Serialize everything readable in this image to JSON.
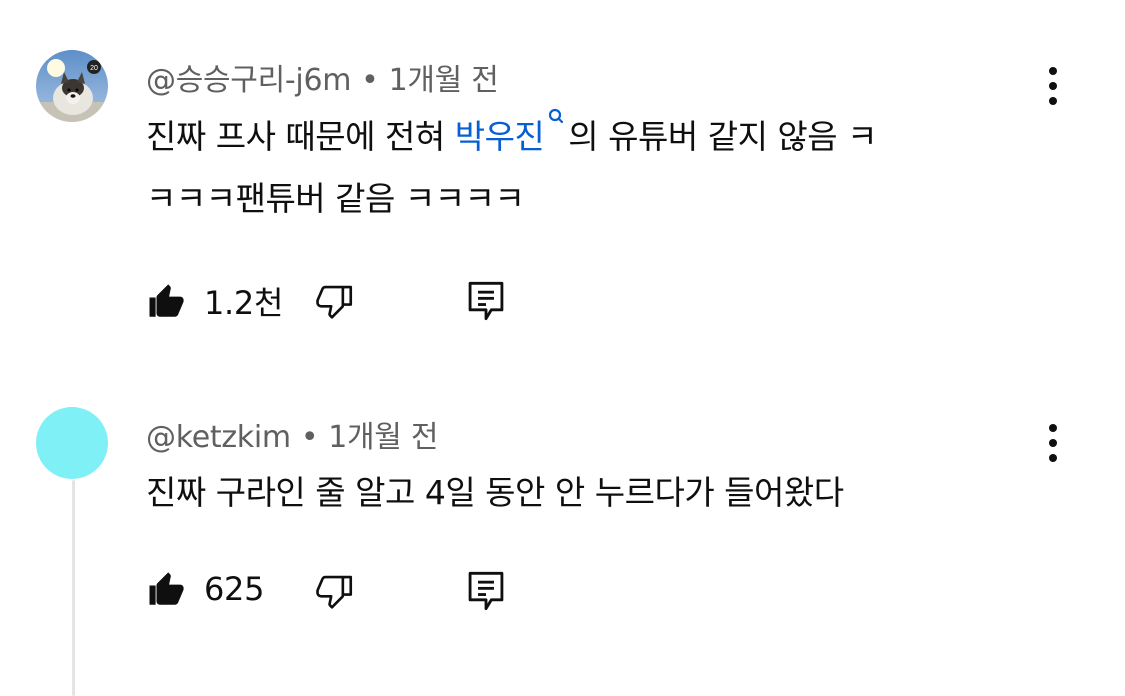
{
  "comments": [
    {
      "handle": "@승승구리-j6m",
      "time": "1개월 전",
      "text_before": "진짜 프사 때문에 전혀 ",
      "mention": "박우진",
      "text_after_line1": "의 유튜버 같지 않음 ㅋ",
      "text_line2": "ㅋㅋㅋ팬튜버 같음 ㅋㅋㅋㅋ",
      "likes": "1.2천",
      "avatar_badge": "20"
    },
    {
      "handle": "@ketzkim",
      "time": "1개월 전",
      "text": "진짜 구라인 줄 알고 4일 동안 안 누르다가 들어왔다",
      "likes": "625",
      "avatar_color": "#7ff0f6"
    }
  ],
  "separator": "•",
  "colors": {
    "mention": "#065fd4",
    "meta": "#606060",
    "text": "#0f0f0f"
  },
  "icons": [
    "like-icon",
    "dislike-icon",
    "reply-icon",
    "more-vert-icon",
    "search-icon"
  ]
}
